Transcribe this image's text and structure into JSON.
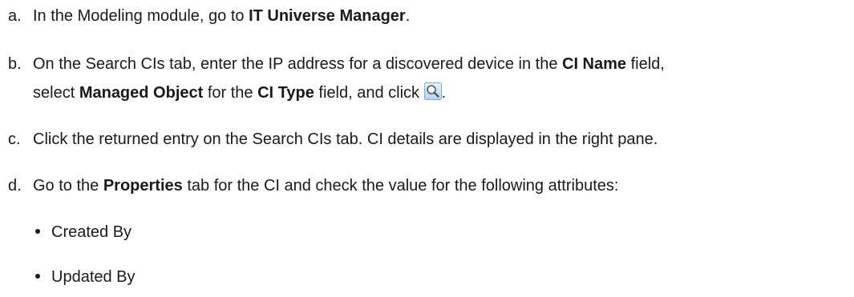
{
  "steps": [
    {
      "marker": "a.",
      "t1": "In the Modeling module, go to ",
      "b1": "IT Universe Manager",
      "t2": "."
    },
    {
      "marker": "b.",
      "t1": "On the Search CIs tab, enter the IP address for a discovered device in the ",
      "b1": "CI Name",
      "t2": " field,",
      "t3": "select ",
      "b2": "Managed Object",
      "t4": " for the ",
      "b3": "CI Type",
      "t5": " field, and click ",
      "t6": "."
    },
    {
      "marker": "c.",
      "t1": "Click the returned entry on the Search CIs tab. CI details are displayed in the right pane."
    },
    {
      "marker": "d.",
      "t1": "Go to the ",
      "b1": "Properties",
      "t2": " tab for the CI and check the value for the following attributes:"
    }
  ],
  "attributes": [
    "Created By",
    "Updated By"
  ],
  "icons": {
    "search": "magnifier-icon"
  },
  "colors": {
    "text": "#1a1a1a",
    "icon_fill_top": "#eaf3fb",
    "icon_fill_bottom": "#b7d2ea",
    "icon_border": "#7fa7cc"
  }
}
